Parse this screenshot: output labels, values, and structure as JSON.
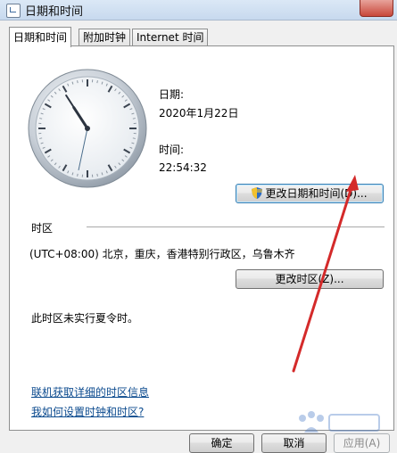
{
  "window": {
    "title": "日期和时间"
  },
  "tabs": [
    {
      "label": "日期和时间"
    },
    {
      "label": "附加时钟"
    },
    {
      "label": "Internet 时间"
    }
  ],
  "clock": {
    "hour": 22,
    "minute": 54,
    "second": 32
  },
  "datetime": {
    "date_label": "日期:",
    "date_value": "2020年1月22日",
    "time_label": "时间:",
    "time_value": "22:54:32",
    "change_button": "更改日期和时间(D)..."
  },
  "timezone": {
    "section_label": "时区",
    "value": "(UTC+08:00) 北京，重庆，香港特别行政区，乌鲁木齐",
    "change_button": "更改时区(Z)...",
    "dst_note": "此时区未实行夏令时。"
  },
  "links": {
    "tz_info": "联机获取详细的时区信息",
    "how_to": "我如何设置时钟和时区?"
  },
  "footer": {
    "ok": "确定",
    "cancel": "取消",
    "apply": "应用(A)"
  },
  "colors": {
    "arrow": "#d42a2a",
    "link": "#0b4a8e"
  }
}
